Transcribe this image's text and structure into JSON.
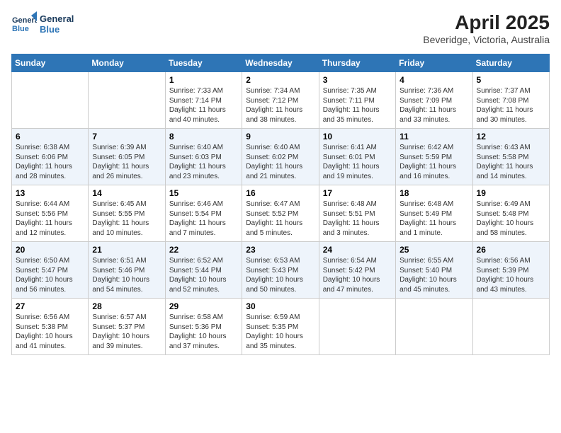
{
  "header": {
    "logo_line1": "General",
    "logo_line2": "Blue",
    "month_title": "April 2025",
    "location": "Beveridge, Victoria, Australia"
  },
  "days_of_week": [
    "Sunday",
    "Monday",
    "Tuesday",
    "Wednesday",
    "Thursday",
    "Friday",
    "Saturday"
  ],
  "weeks": [
    [
      {
        "day": "",
        "info": ""
      },
      {
        "day": "",
        "info": ""
      },
      {
        "day": "1",
        "info": "Sunrise: 7:33 AM\nSunset: 7:14 PM\nDaylight: 11 hours and 40 minutes."
      },
      {
        "day": "2",
        "info": "Sunrise: 7:34 AM\nSunset: 7:12 PM\nDaylight: 11 hours and 38 minutes."
      },
      {
        "day": "3",
        "info": "Sunrise: 7:35 AM\nSunset: 7:11 PM\nDaylight: 11 hours and 35 minutes."
      },
      {
        "day": "4",
        "info": "Sunrise: 7:36 AM\nSunset: 7:09 PM\nDaylight: 11 hours and 33 minutes."
      },
      {
        "day": "5",
        "info": "Sunrise: 7:37 AM\nSunset: 7:08 PM\nDaylight: 11 hours and 30 minutes."
      }
    ],
    [
      {
        "day": "6",
        "info": "Sunrise: 6:38 AM\nSunset: 6:06 PM\nDaylight: 11 hours and 28 minutes."
      },
      {
        "day": "7",
        "info": "Sunrise: 6:39 AM\nSunset: 6:05 PM\nDaylight: 11 hours and 26 minutes."
      },
      {
        "day": "8",
        "info": "Sunrise: 6:40 AM\nSunset: 6:03 PM\nDaylight: 11 hours and 23 minutes."
      },
      {
        "day": "9",
        "info": "Sunrise: 6:40 AM\nSunset: 6:02 PM\nDaylight: 11 hours and 21 minutes."
      },
      {
        "day": "10",
        "info": "Sunrise: 6:41 AM\nSunset: 6:01 PM\nDaylight: 11 hours and 19 minutes."
      },
      {
        "day": "11",
        "info": "Sunrise: 6:42 AM\nSunset: 5:59 PM\nDaylight: 11 hours and 16 minutes."
      },
      {
        "day": "12",
        "info": "Sunrise: 6:43 AM\nSunset: 5:58 PM\nDaylight: 11 hours and 14 minutes."
      }
    ],
    [
      {
        "day": "13",
        "info": "Sunrise: 6:44 AM\nSunset: 5:56 PM\nDaylight: 11 hours and 12 minutes."
      },
      {
        "day": "14",
        "info": "Sunrise: 6:45 AM\nSunset: 5:55 PM\nDaylight: 11 hours and 10 minutes."
      },
      {
        "day": "15",
        "info": "Sunrise: 6:46 AM\nSunset: 5:54 PM\nDaylight: 11 hours and 7 minutes."
      },
      {
        "day": "16",
        "info": "Sunrise: 6:47 AM\nSunset: 5:52 PM\nDaylight: 11 hours and 5 minutes."
      },
      {
        "day": "17",
        "info": "Sunrise: 6:48 AM\nSunset: 5:51 PM\nDaylight: 11 hours and 3 minutes."
      },
      {
        "day": "18",
        "info": "Sunrise: 6:48 AM\nSunset: 5:49 PM\nDaylight: 11 hours and 1 minute."
      },
      {
        "day": "19",
        "info": "Sunrise: 6:49 AM\nSunset: 5:48 PM\nDaylight: 10 hours and 58 minutes."
      }
    ],
    [
      {
        "day": "20",
        "info": "Sunrise: 6:50 AM\nSunset: 5:47 PM\nDaylight: 10 hours and 56 minutes."
      },
      {
        "day": "21",
        "info": "Sunrise: 6:51 AM\nSunset: 5:46 PM\nDaylight: 10 hours and 54 minutes."
      },
      {
        "day": "22",
        "info": "Sunrise: 6:52 AM\nSunset: 5:44 PM\nDaylight: 10 hours and 52 minutes."
      },
      {
        "day": "23",
        "info": "Sunrise: 6:53 AM\nSunset: 5:43 PM\nDaylight: 10 hours and 50 minutes."
      },
      {
        "day": "24",
        "info": "Sunrise: 6:54 AM\nSunset: 5:42 PM\nDaylight: 10 hours and 47 minutes."
      },
      {
        "day": "25",
        "info": "Sunrise: 6:55 AM\nSunset: 5:40 PM\nDaylight: 10 hours and 45 minutes."
      },
      {
        "day": "26",
        "info": "Sunrise: 6:56 AM\nSunset: 5:39 PM\nDaylight: 10 hours and 43 minutes."
      }
    ],
    [
      {
        "day": "27",
        "info": "Sunrise: 6:56 AM\nSunset: 5:38 PM\nDaylight: 10 hours and 41 minutes."
      },
      {
        "day": "28",
        "info": "Sunrise: 6:57 AM\nSunset: 5:37 PM\nDaylight: 10 hours and 39 minutes."
      },
      {
        "day": "29",
        "info": "Sunrise: 6:58 AM\nSunset: 5:36 PM\nDaylight: 10 hours and 37 minutes."
      },
      {
        "day": "30",
        "info": "Sunrise: 6:59 AM\nSunset: 5:35 PM\nDaylight: 10 hours and 35 minutes."
      },
      {
        "day": "",
        "info": ""
      },
      {
        "day": "",
        "info": ""
      },
      {
        "day": "",
        "info": ""
      }
    ]
  ]
}
